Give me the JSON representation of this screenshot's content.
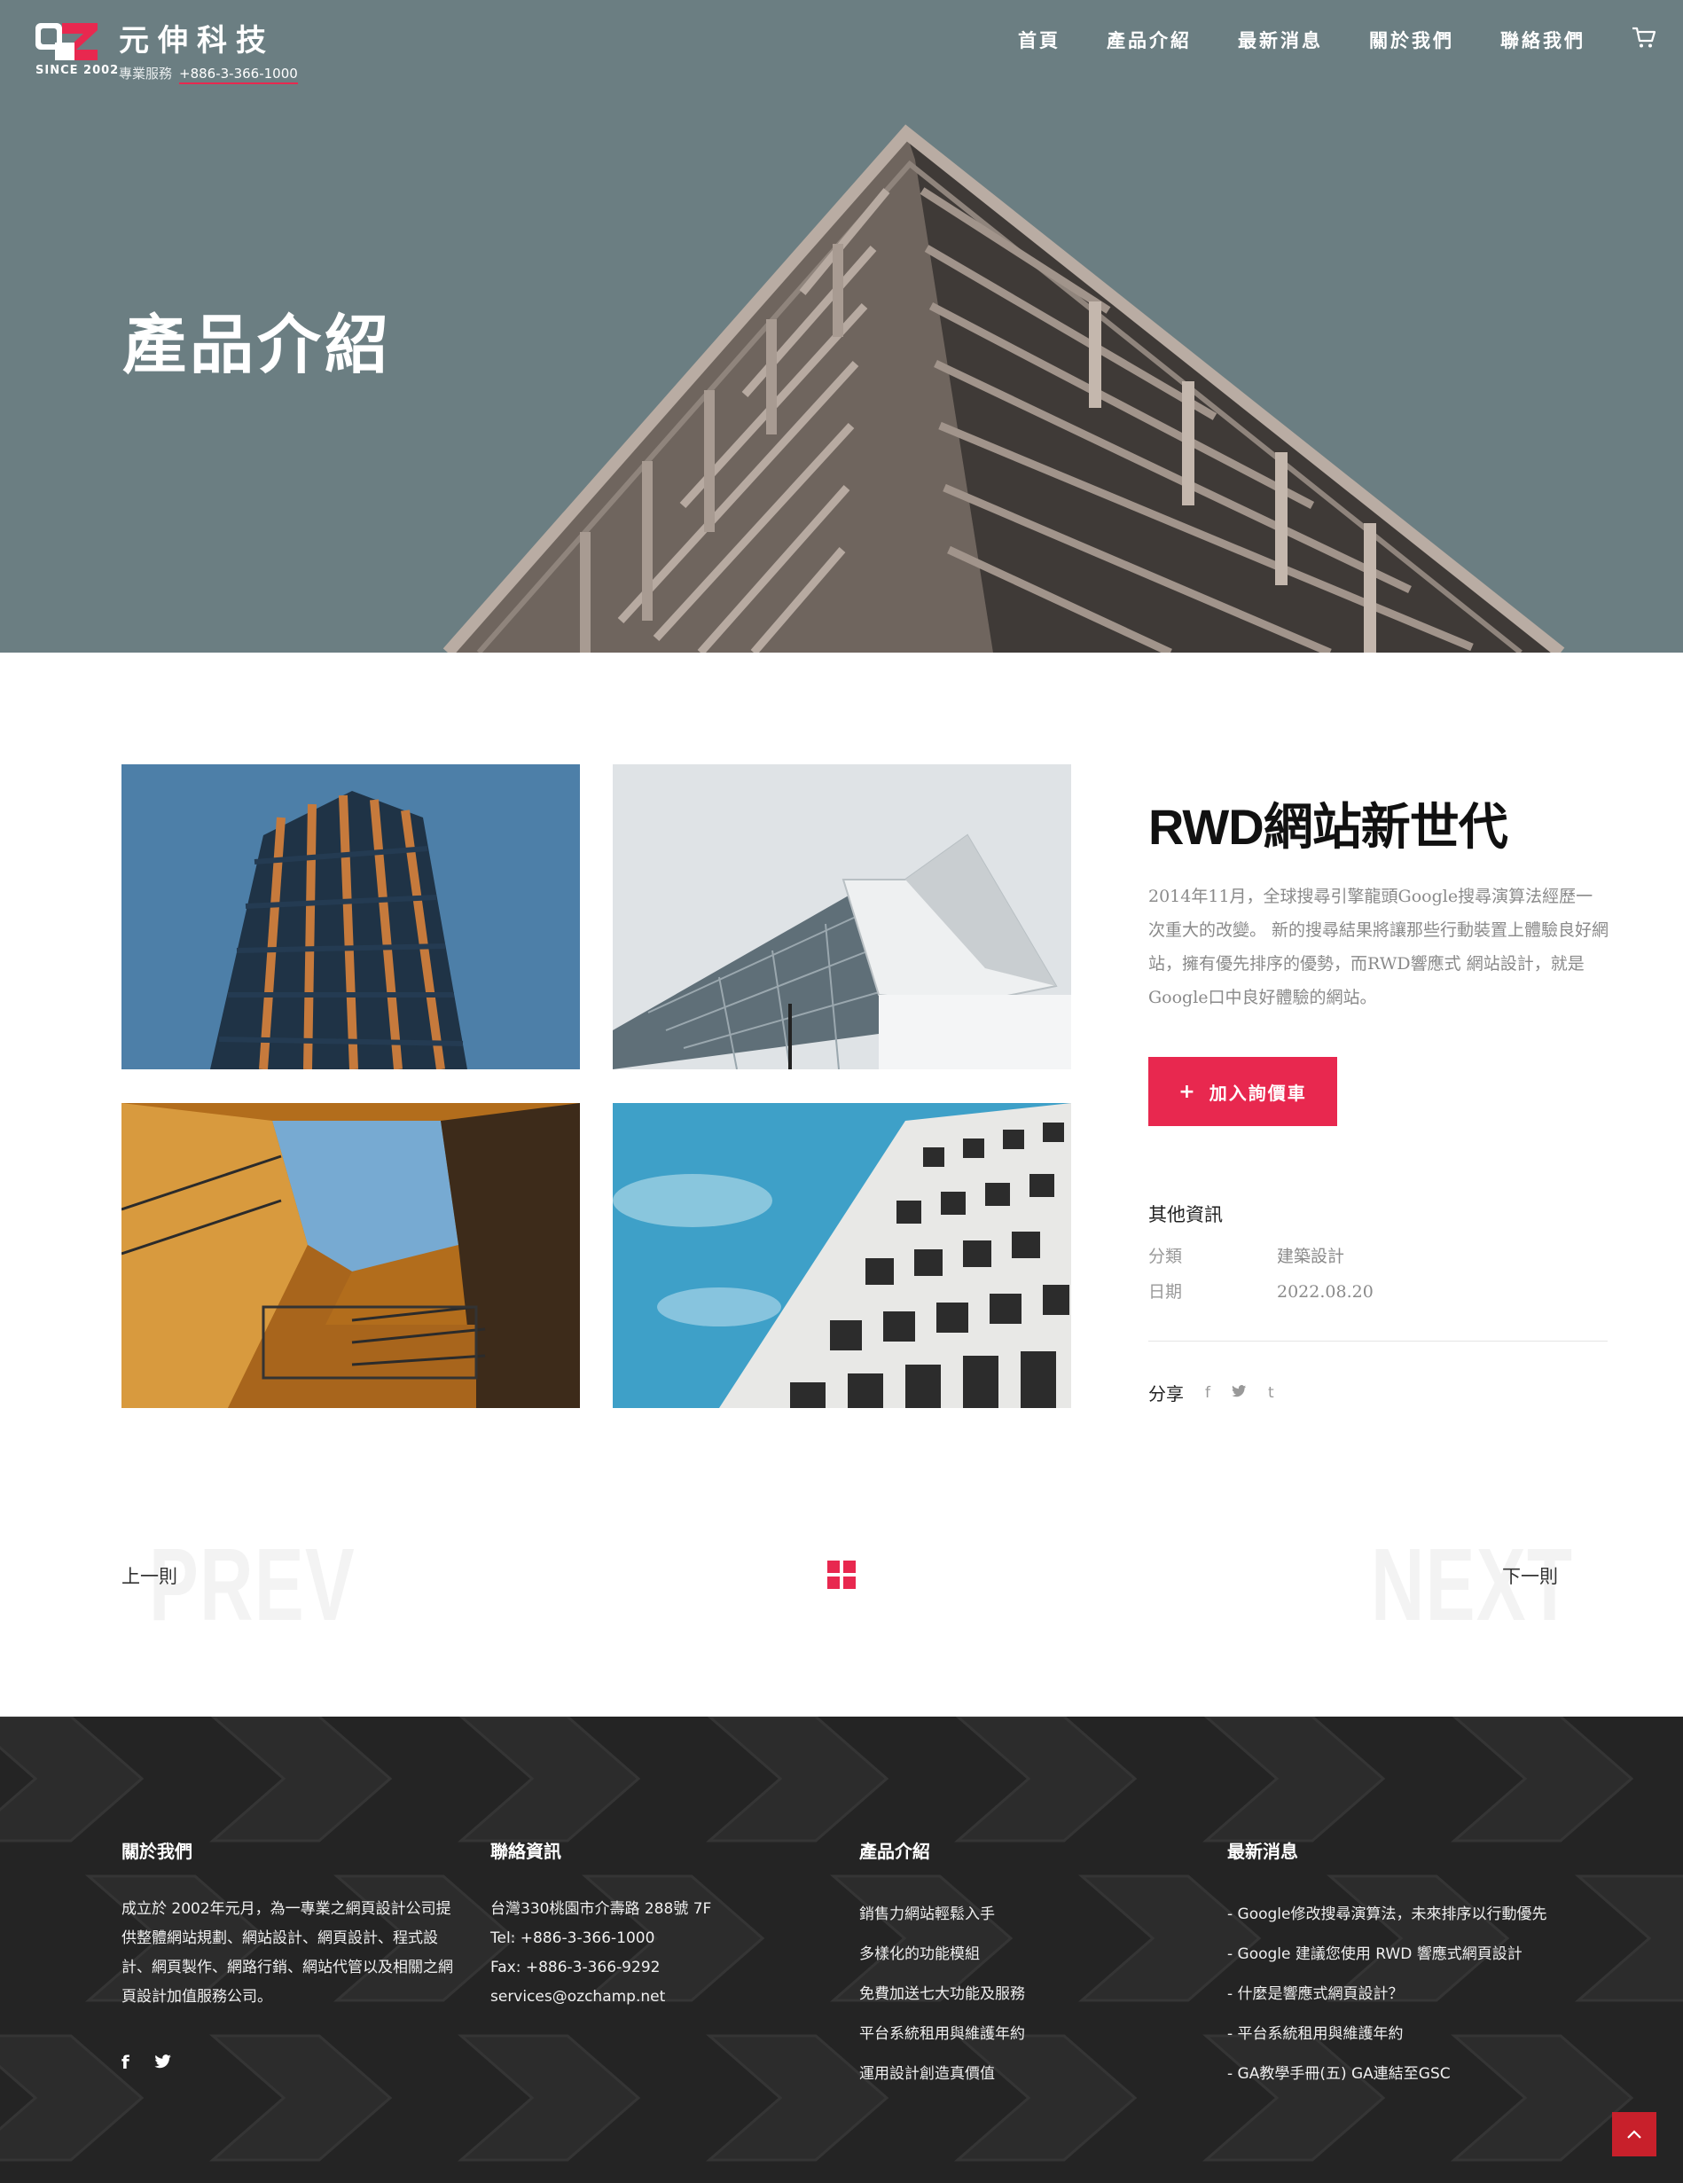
{
  "brand": {
    "name": "元伸科技",
    "since": "SINCE 2002",
    "service_label": "專業服務",
    "phone": "+886-3-366-1000"
  },
  "nav": {
    "items": [
      {
        "label": "首頁"
      },
      {
        "label": "產品介紹"
      },
      {
        "label": "最新消息"
      },
      {
        "label": "關於我們"
      },
      {
        "label": "聯絡我們"
      }
    ],
    "cart_icon": "cart-icon"
  },
  "hero": {
    "title": "產品介紹"
  },
  "product": {
    "title_en": "RWD",
    "title_zh": "網站新世代",
    "description": "2014年11月，全球搜尋引擎龍頭Google搜尋演算法經歷一次重大的改變。 新的搜尋結果將讓那些行動裝置上體驗良好網站，擁有優先排序的優勢，而RWD響應式 網站設計，就是Google口中良好體驗的網站。",
    "inquiry_button": "加入詢價車",
    "other_info_title": "其他資訊",
    "category_label": "分類",
    "category_value": "建築設計",
    "date_label": "日期",
    "date_value": "2022.08.20",
    "share_label": "分享",
    "share_icons": [
      "facebook-icon",
      "twitter-icon",
      "tumblr-icon"
    ]
  },
  "pagination": {
    "prev_bg": "PREV",
    "next_bg": "NEXT",
    "prev_label": "上一則",
    "next_label": "下一則"
  },
  "footer": {
    "about": {
      "title": "關於我們",
      "text": "成立於 2002年元月，為一專業之網頁設計公司提供整體網站規劃、網站設計、網頁設計、程式設計、網頁製作、網路行銷、網站代管以及相關之網頁設計加值服務公司。"
    },
    "contact": {
      "title": "聯絡資訊",
      "address": "台灣330桃園市介壽路 288號 7F",
      "tel": "Tel: +886-3-366-1000",
      "fax": "Fax: +886-3-366-9292",
      "email": "services@ozchamp.net"
    },
    "products": {
      "title": "產品介紹",
      "items": [
        "銷售力網站輕鬆入手",
        "多樣化的功能模組",
        "免費加送七大功能及服務",
        "平台系統租用與維護年約",
        "運用設計創造真價值"
      ]
    },
    "news": {
      "title": "最新消息",
      "items": [
        "- Google修改搜尋演算法，未來排序以行動優先",
        "- Google 建議您使用 RWD 響應式網頁設計",
        "- 什麼是響應式網頁設計？",
        "- 平台系統租用與維護年約",
        "- GA教學手冊(五) GA連結至GSC"
      ]
    },
    "social_icons": [
      "facebook-icon",
      "twitter-icon"
    ]
  },
  "colors": {
    "accent": "#e8284f",
    "hero_sky": "#6b7e82",
    "footer_bg": "#2a2a2a",
    "to_top": "#c8202b"
  }
}
